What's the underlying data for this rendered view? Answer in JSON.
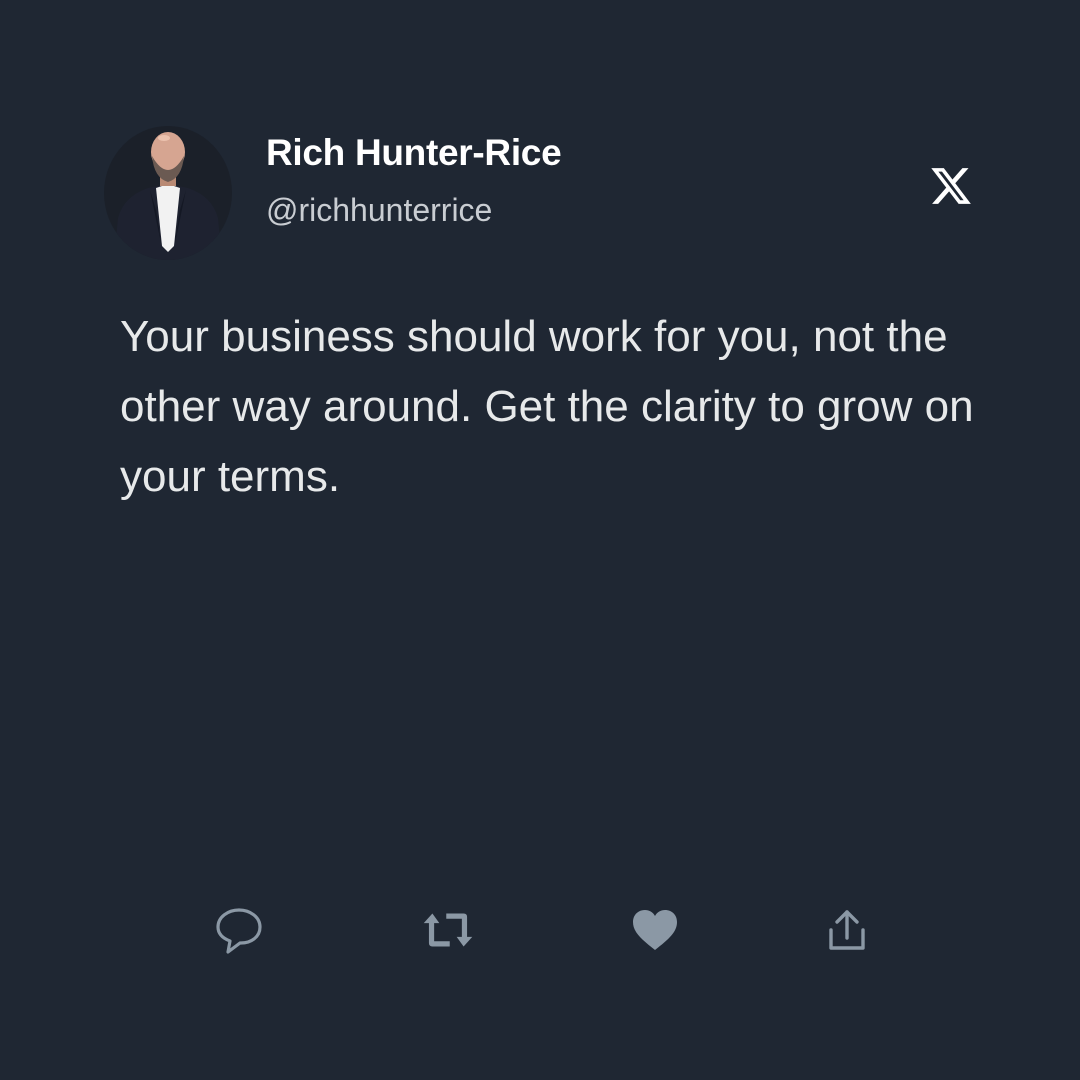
{
  "author": {
    "display_name": "Rich Hunter-Rice",
    "handle": "@richhunterrice"
  },
  "tweet": {
    "text": "Your business should work for you, not the other way around. Get the clarity to grow on your terms."
  },
  "icons": {
    "brand": "x-logo-icon",
    "actions": [
      "reply-icon",
      "retweet-icon",
      "like-icon",
      "share-icon"
    ]
  },
  "colors": {
    "background": "#1f2733",
    "text": "#e7e9ea",
    "handle": "#c9cdd2",
    "action_icons": "#8b98a5"
  }
}
